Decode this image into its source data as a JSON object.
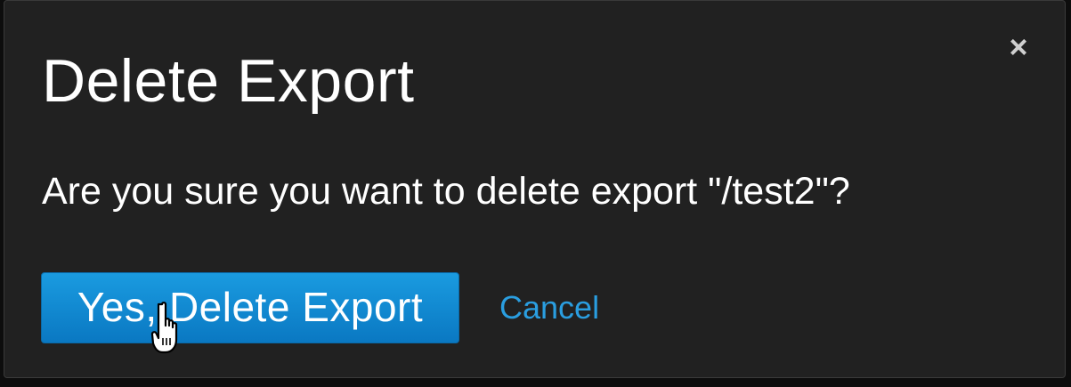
{
  "dialog": {
    "title": "Delete Export",
    "close_symbol": "×",
    "message": "Are you sure you want to delete export \"/test2\"?",
    "confirm_label": "Yes, Delete Export",
    "cancel_label": "Cancel"
  },
  "icons": {
    "close": "close-icon",
    "cursor": "hand-pointer-icon"
  },
  "colors": {
    "background": "#212121",
    "primary_button": "#1a9be0",
    "link": "#2a9ee0",
    "text": "#ffffff"
  }
}
